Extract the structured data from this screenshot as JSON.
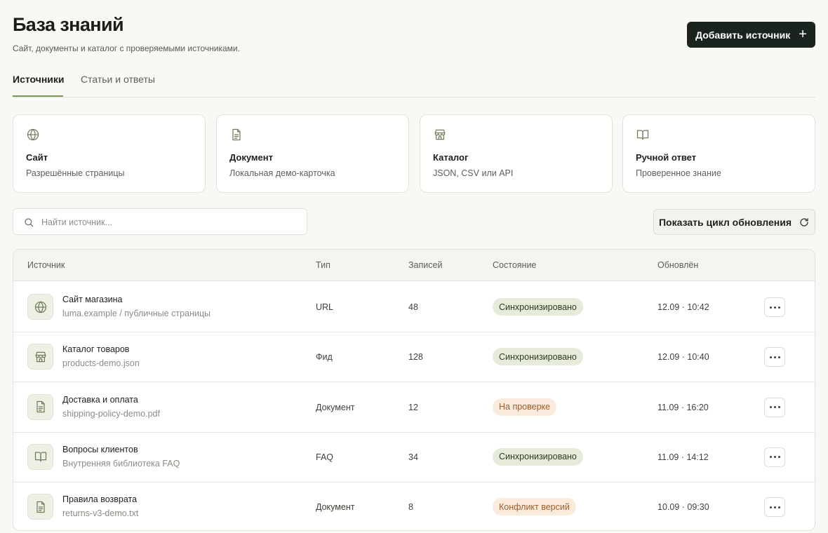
{
  "header": {
    "title": "База знаний",
    "subtitle": "Сайт, документы и каталог с проверяемыми источниками.",
    "add_button_label": "Добавить источник",
    "add_button_icon": "plus-icon"
  },
  "tabs": [
    {
      "label": "Источники",
      "active": true
    },
    {
      "label": "Статьи и ответы",
      "active": false
    }
  ],
  "source_types": [
    {
      "icon": "globe-icon",
      "title": "Сайт",
      "description": "Разрешённые страницы"
    },
    {
      "icon": "document-icon",
      "title": "Документ",
      "description": "Локальная демо-карточка"
    },
    {
      "icon": "store-icon",
      "title": "Каталог",
      "description": "JSON, CSV или API"
    },
    {
      "icon": "book-icon",
      "title": "Ручной ответ",
      "description": "Проверенное знание"
    }
  ],
  "search": {
    "placeholder": "Найти источник...",
    "value": "",
    "icon": "search-icon"
  },
  "cycle_button": {
    "label": "Показать цикл обновления",
    "icon": "refresh-icon"
  },
  "table": {
    "columns": {
      "source": "Источник",
      "type": "Тип",
      "records": "Записей",
      "state": "Состояние",
      "updated": "Обновлён"
    },
    "rows": [
      {
        "icon": "globe-icon",
        "name": "Сайт магазина",
        "sub": "luma.example / публичные страницы",
        "type": "URL",
        "records": "48",
        "state": "Синхронизировано",
        "state_kind": "ok",
        "updated": "12.09 · 10:42"
      },
      {
        "icon": "store-icon",
        "name": "Каталог товаров",
        "sub": "products-demo.json",
        "type": "Фид",
        "records": "128",
        "state": "Синхронизировано",
        "state_kind": "ok",
        "updated": "12.09 · 10:40"
      },
      {
        "icon": "document-icon",
        "name": "Доставка и оплата",
        "sub": "shipping-policy-demo.pdf",
        "type": "Документ",
        "records": "12",
        "state": "На проверке",
        "state_kind": "warn",
        "updated": "11.09 · 16:20"
      },
      {
        "icon": "book-icon",
        "name": "Вопросы клиентов",
        "sub": "Внутренняя библиотека FAQ",
        "type": "FAQ",
        "records": "34",
        "state": "Синхронизировано",
        "state_kind": "ok",
        "updated": "11.09 · 14:12"
      },
      {
        "icon": "document-icon",
        "name": "Правила возврата",
        "sub": "returns-v3-demo.txt",
        "type": "Документ",
        "records": "8",
        "state": "Конфликт версий",
        "state_kind": "warn",
        "updated": "10.09 · 09:30"
      }
    ]
  },
  "colors": {
    "accent": "#7e9361",
    "primary_button": "#1b231e",
    "badge_ok_bg": "#e6ecd9",
    "badge_warn_bg": "#fbebdc",
    "badge_warn_text": "#9c5d2a"
  }
}
